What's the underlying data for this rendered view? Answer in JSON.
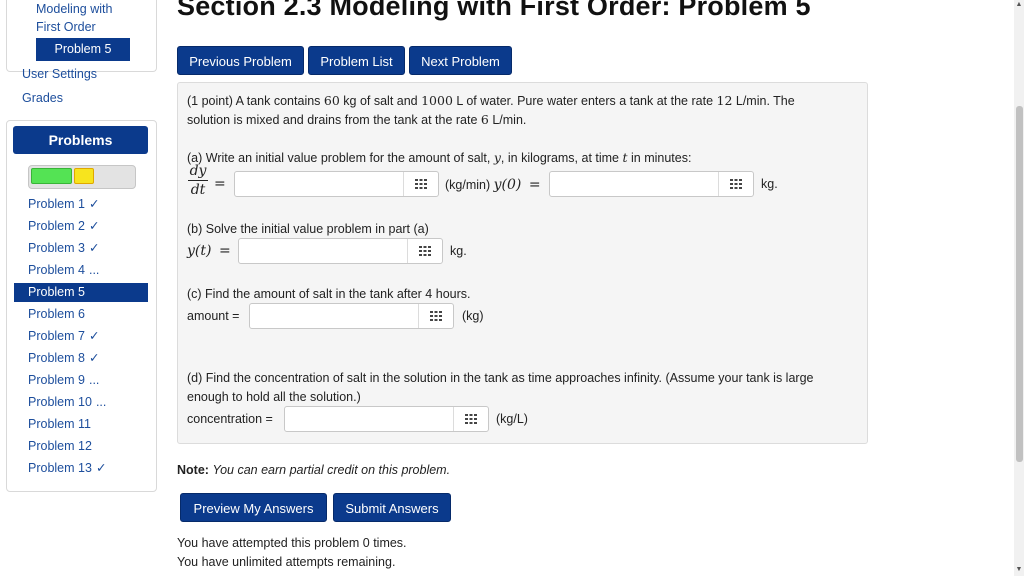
{
  "nav": {
    "section_link": "Modeling with First Order",
    "section_link_line1": "Modeling with",
    "section_link_line2": "First Order",
    "current_problem": "Problem 5",
    "user_settings": "User Settings",
    "grades": "Grades"
  },
  "problems_panel": {
    "header": "Problems",
    "progress": {
      "correct_fraction": 0.4,
      "partial_fraction": 0.2
    },
    "items": [
      {
        "label": "Problem 1",
        "status": "✓"
      },
      {
        "label": "Problem 2",
        "status": "✓"
      },
      {
        "label": "Problem 3",
        "status": "✓"
      },
      {
        "label": "Problem 4",
        "status": "..."
      },
      {
        "label": "Problem 5",
        "status": ""
      },
      {
        "label": "Problem 6",
        "status": ""
      },
      {
        "label": "Problem 7",
        "status": "✓"
      },
      {
        "label": "Problem 8",
        "status": "✓"
      },
      {
        "label": "Problem 9",
        "status": "..."
      },
      {
        "label": "Problem 10",
        "status": "..."
      },
      {
        "label": "Problem 11",
        "status": ""
      },
      {
        "label": "Problem 12",
        "status": ""
      },
      {
        "label": "Problem 13",
        "status": "✓"
      }
    ]
  },
  "header": {
    "title": "Section 2.3 Modeling with First Order: Problem 5",
    "prev_button": "Previous Problem",
    "list_button": "Problem List",
    "next_button": "Next Problem"
  },
  "problem": {
    "intro_line1_a": "(1 point) A tank contains ",
    "salt_amount": "60",
    "intro_line1_b": " kg of salt and ",
    "water_amount": "1000",
    "intro_line1_c": " L of water. Pure water enters a tank at the rate ",
    "in_rate": "12",
    "intro_line1_d": " L/min. The",
    "intro_line2_a": "solution is mixed and drains from the tank at the rate ",
    "out_rate": "6",
    "intro_line2_b": " L/min.",
    "part_a": {
      "prompt_a": "(a) Write an initial value problem for the amount of salt, ",
      "var_y": "y",
      "prompt_b": ", in kilograms, at time ",
      "var_t": "t",
      "prompt_c": " in minutes:",
      "deriv_num": "dy",
      "deriv_den": "dt",
      "equals": "=",
      "unit1": "(kg/min)",
      "init_label": "y(0)",
      "equals2": "=",
      "unit2": "kg.",
      "answer1": "",
      "answer2": ""
    },
    "part_b": {
      "prompt": "(b) Solve the initial value problem in part (a)",
      "lhs": "y(t)",
      "equals": "=",
      "unit": "kg.",
      "answer": ""
    },
    "part_c": {
      "prompt": "(c) Find the amount of salt in the tank after 4 hours.",
      "label": "amount =",
      "unit": "(kg)",
      "answer": ""
    },
    "part_d": {
      "prompt_line1": "(d) Find the concentration of salt in the solution in the tank as time approaches infinity. (Assume your tank is large",
      "prompt_line2": "enough to hold all the solution.)",
      "label": "concentration =",
      "unit": "(kg/L)",
      "answer": ""
    }
  },
  "note": {
    "label": "Note:",
    "text": "You can earn partial credit on this problem."
  },
  "actions": {
    "preview_button": "Preview My Answers",
    "submit_button": "Submit Answers"
  },
  "attempts": {
    "line1": "You have attempted this problem 0 times.",
    "line2": "You have unlimited attempts remaining."
  },
  "icons": {
    "equation_editor": "grid-icon"
  },
  "colors": {
    "primary": "#0b3a8c",
    "link": "#1d4e9c",
    "progress_correct": "#54e354",
    "progress_partial": "#f7e41e"
  }
}
